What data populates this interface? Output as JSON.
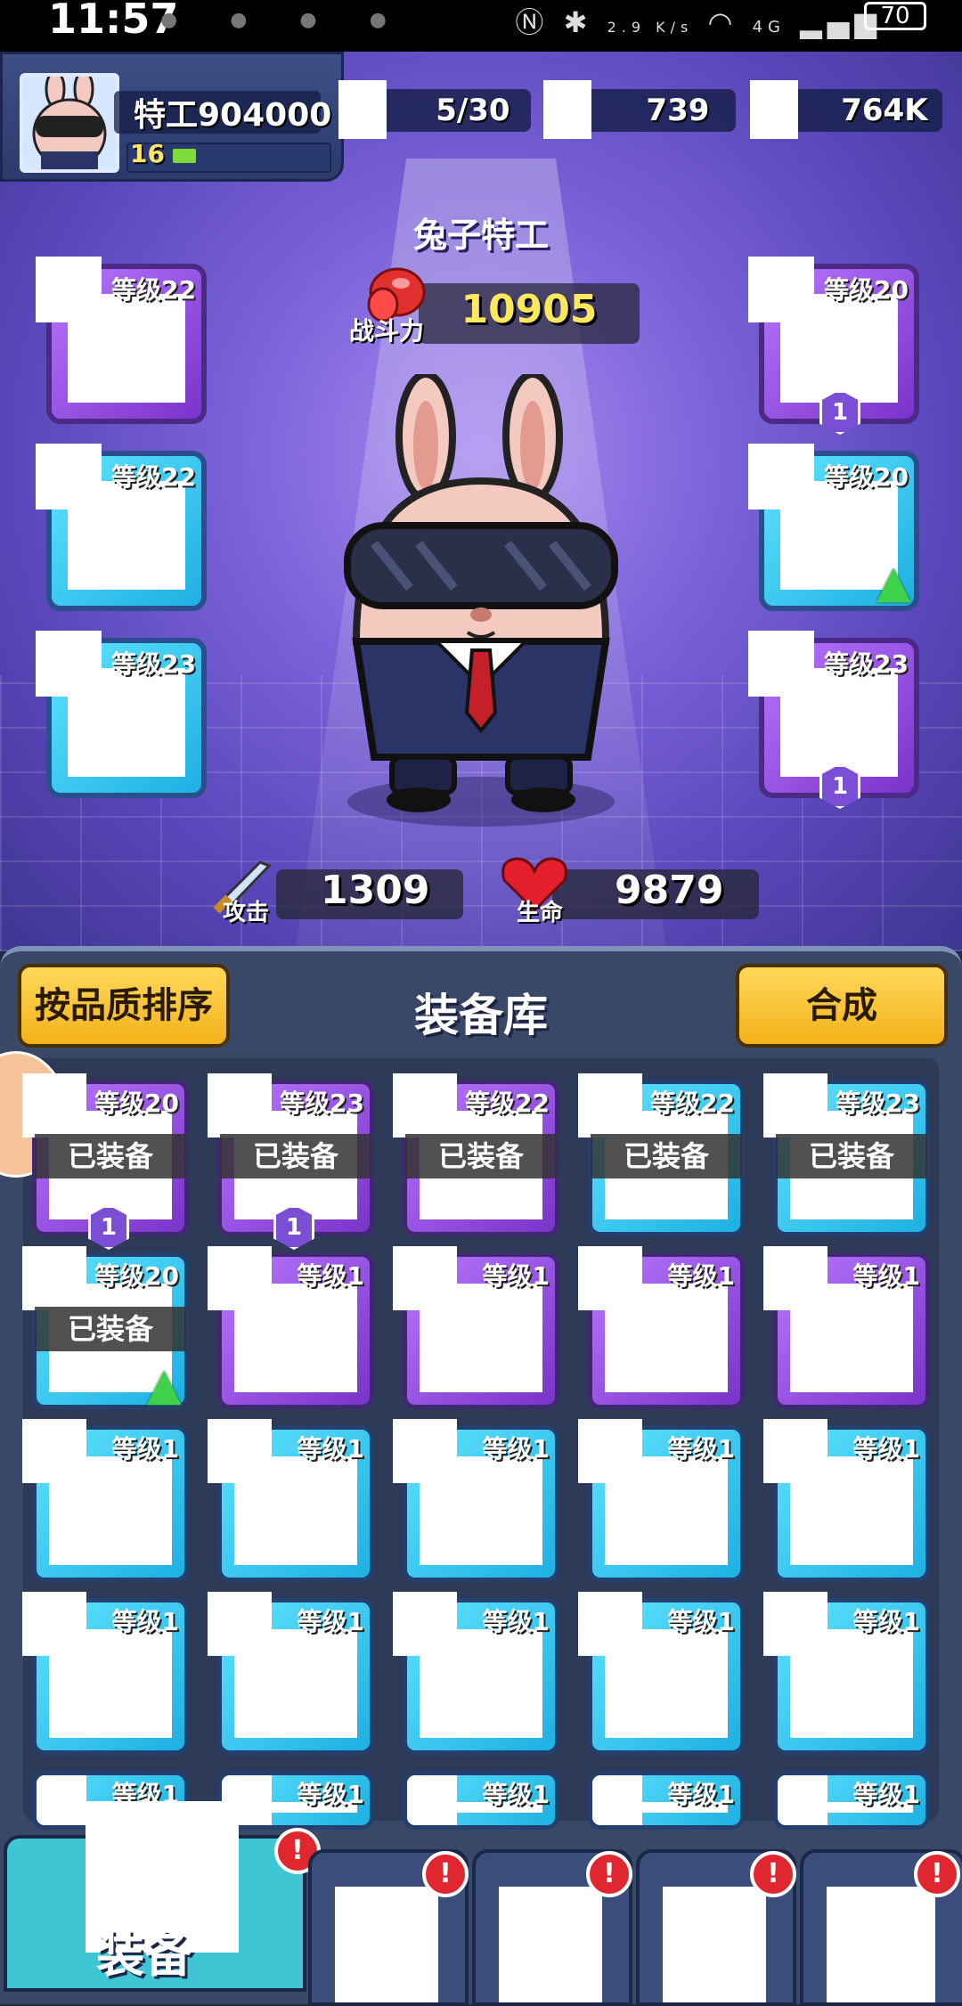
{
  "status_bar": {
    "time": "11:57",
    "net_speed": "2.9 K/s",
    "network": "4G",
    "battery": "70"
  },
  "player": {
    "name": "特工904000",
    "level": "16",
    "xp_fraction": 0.15,
    "resources": [
      {
        "icon": "energy-icon",
        "value": "5/30"
      },
      {
        "icon": "gem-icon",
        "value": "739"
      },
      {
        "icon": "coin-icon",
        "value": "764K"
      }
    ]
  },
  "hero": {
    "name": "兔子特工",
    "power_label": "战斗力",
    "power": "10905",
    "attack_label": "攻击",
    "attack": "1309",
    "hp_label": "生命",
    "hp": "9879"
  },
  "equipped_slots": {
    "left": [
      {
        "level": "等级22",
        "rarity": "purple"
      },
      {
        "level": "等级22",
        "rarity": "blue"
      },
      {
        "level": "等级23",
        "rarity": "blue"
      }
    ],
    "right": [
      {
        "level": "等级20",
        "rarity": "purple",
        "badge": "1"
      },
      {
        "level": "等级20",
        "rarity": "blue",
        "upgrade": true
      },
      {
        "level": "等级23",
        "rarity": "purple",
        "badge": "1"
      }
    ]
  },
  "inventory": {
    "title": "装备库",
    "sort_button": "按品质排序",
    "merge_button": "合成",
    "equipped_label": "已装备",
    "badge_one": "1",
    "items": [
      {
        "level": "等级20",
        "rarity": "purple",
        "equipped": true,
        "badge": "1"
      },
      {
        "level": "等级23",
        "rarity": "purple",
        "equipped": true,
        "badge": "1"
      },
      {
        "level": "等级22",
        "rarity": "purple",
        "equipped": true
      },
      {
        "level": "等级22",
        "rarity": "blue",
        "equipped": true
      },
      {
        "level": "等级23",
        "rarity": "blue",
        "equipped": true
      },
      {
        "level": "等级20",
        "rarity": "blue",
        "equipped": true,
        "upgrade": true
      },
      {
        "level": "等级1",
        "rarity": "purple"
      },
      {
        "level": "等级1",
        "rarity": "purple"
      },
      {
        "level": "等级1",
        "rarity": "purple"
      },
      {
        "level": "等级1",
        "rarity": "purple"
      },
      {
        "level": "等级1",
        "rarity": "blue"
      },
      {
        "level": "等级1",
        "rarity": "blue"
      },
      {
        "level": "等级1",
        "rarity": "blue"
      },
      {
        "level": "等级1",
        "rarity": "blue"
      },
      {
        "level": "等级1",
        "rarity": "blue"
      },
      {
        "level": "等级1",
        "rarity": "blue"
      },
      {
        "level": "等级1",
        "rarity": "blue"
      },
      {
        "level": "等级1",
        "rarity": "blue"
      },
      {
        "level": "等级1",
        "rarity": "blue"
      },
      {
        "level": "等级1",
        "rarity": "blue"
      },
      {
        "level": "等级1",
        "rarity": "blue"
      },
      {
        "level": "等级1",
        "rarity": "blue"
      },
      {
        "level": "等级1",
        "rarity": "blue"
      },
      {
        "level": "等级1",
        "rarity": "blue"
      },
      {
        "level": "等级1",
        "rarity": "blue"
      }
    ]
  },
  "bottom_nav": {
    "active_label": "装备",
    "alert": "!"
  }
}
